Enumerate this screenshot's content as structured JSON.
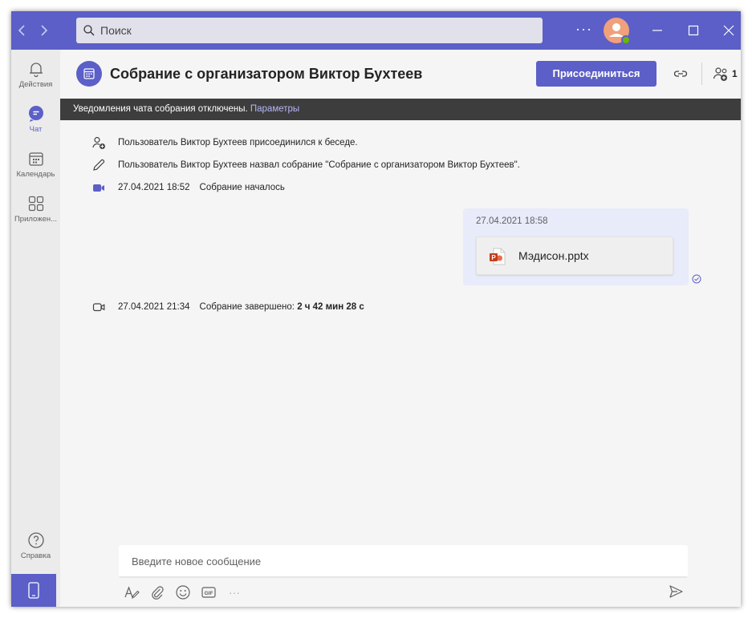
{
  "search": {
    "placeholder": "Поиск"
  },
  "titlebar": {
    "more": "···"
  },
  "rail": {
    "items": [
      {
        "label": "Действия",
        "icon": "bell-icon"
      },
      {
        "label": "Чат",
        "icon": "chat-icon"
      },
      {
        "label": "Календарь",
        "icon": "calendar-icon"
      },
      {
        "label": "Приложен...",
        "icon": "apps-icon"
      }
    ],
    "help": {
      "label": "Справка",
      "icon": "help-icon"
    }
  },
  "header": {
    "title": "Собрание с организатором Виктор Бухтеев",
    "join_label": "Присоединиться",
    "participants_count": "1"
  },
  "banner": {
    "text": "Уведомления чата собрания отключены.",
    "link": "Параметры"
  },
  "messages": {
    "joined": "Пользователь Виктор Бухтеев присоединился к беседе.",
    "renamed": "Пользователь Виктор Бухтеев назвал собрание \"Собрание с организатором Виктор Бухтеев\".",
    "started": {
      "time": "27.04.2021 18:52",
      "text": "Собрание началось"
    },
    "bubble": {
      "time": "27.04.2021 18:58",
      "file": "Мэдисон.pptx"
    },
    "ended": {
      "time": "27.04.2021 21:34",
      "text": "Собрание завершено:",
      "duration": "2 ч 42 мин 28 с"
    }
  },
  "composer": {
    "placeholder": "Введите новое сообщение",
    "more": "···"
  },
  "colors": {
    "brand": "#5b5fc7",
    "banner": "#3d3d3d",
    "bubble": "#e8ebfa",
    "presence": "#6bb700",
    "pptx": "#c43e1c"
  }
}
